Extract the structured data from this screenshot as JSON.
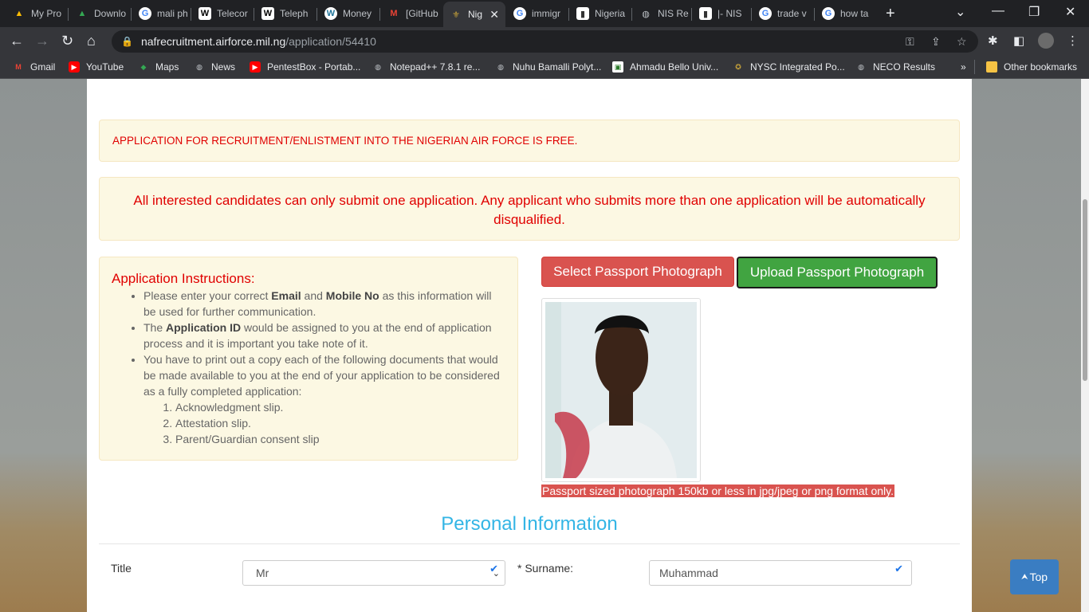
{
  "browser": {
    "tabs": [
      {
        "label": "My Pro",
        "icon": "google-drive-icon"
      },
      {
        "label": "Downlo",
        "icon": "google-drive-icon"
      },
      {
        "label": "mali ph",
        "icon": "google-icon"
      },
      {
        "label": "Telecor",
        "icon": "wikipedia-icon"
      },
      {
        "label": "Teleph",
        "icon": "wikipedia-icon"
      },
      {
        "label": "Money",
        "icon": "wordpress-icon"
      },
      {
        "label": "[GitHub",
        "icon": "gmail-icon"
      },
      {
        "label": "Nig",
        "icon": "naf-crest-icon"
      },
      {
        "label": "immigr",
        "icon": "google-icon"
      },
      {
        "label": "Nigeria",
        "icon": "page-icon"
      },
      {
        "label": "NIS Re",
        "icon": "globe-icon"
      },
      {
        "label": "|- NIS",
        "icon": "page-icon"
      },
      {
        "label": "trade v",
        "icon": "google-icon"
      },
      {
        "label": "how ta",
        "icon": "google-icon"
      }
    ],
    "new_tab_label": "+",
    "url_host": "nafrecruitment.airforce.mil.ng",
    "url_path": "/application/54410",
    "bookmarks": [
      {
        "label": "Gmail",
        "icon": "gmail-icon"
      },
      {
        "label": "YouTube",
        "icon": "youtube-icon"
      },
      {
        "label": "Maps",
        "icon": "maps-icon"
      },
      {
        "label": "News",
        "icon": "globe-icon"
      },
      {
        "label": "PentestBox - Portab...",
        "icon": "youtube-icon"
      },
      {
        "label": "Notepad++ 7.8.1 re...",
        "icon": "globe-icon"
      },
      {
        "label": "Nuhu Bamalli Polyt...",
        "icon": "globe-icon"
      },
      {
        "label": "Ahmadu Bello Univ...",
        "icon": "abu-icon"
      },
      {
        "label": "NYSC Integrated Po...",
        "icon": "nysc-icon"
      },
      {
        "label": "NECO Results",
        "icon": "globe-icon"
      }
    ],
    "bookmarks_overflow": "»",
    "other_bookmarks": "Other bookmarks"
  },
  "page": {
    "notice_free": "APPLICATION FOR RECRUITMENT/ENLISTMENT INTO THE NIGERIAN AIR FORCE IS FREE.",
    "notice_one_application": "All interested candidates can only submit one application. Any applicant who submits more than one application will be automatically disqualified.",
    "instructions": {
      "heading": "Application Instructions:",
      "item1_a": "Please enter your correct ",
      "item1_b1": "Email",
      "item1_c": " and ",
      "item1_b2": "Mobile No",
      "item1_d": " as this information will be used for further communication.",
      "item2_a": "The ",
      "item2_b": "Application ID",
      "item2_c": " would be assigned to you at the end of application process and it is important you take note of it.",
      "item3": "You have to print out a copy each of the following documents that would be made available to you at the end of your application to be considered as a fully completed application:",
      "docs": [
        "Acknowledgment slip.",
        "Attestation slip.",
        "Parent/Guardian consent slip"
      ]
    },
    "select_photo_label": "Select Passport Photograph",
    "upload_photo_label": "Upload Passport Photograph",
    "photo_note": "Passport sized photograph 150kb or less in jpg/jpeg or png format only.",
    "section_title": "Personal Information",
    "title_label": "Title",
    "title_value": "Mr",
    "surname_label": "* Surname:",
    "surname_value": "Muhammad",
    "top_button": "Top"
  },
  "colors": {
    "alert_red": "#e00000",
    "accent_blue": "#33b5e5",
    "danger": "#d9534f",
    "success": "#41a441"
  }
}
